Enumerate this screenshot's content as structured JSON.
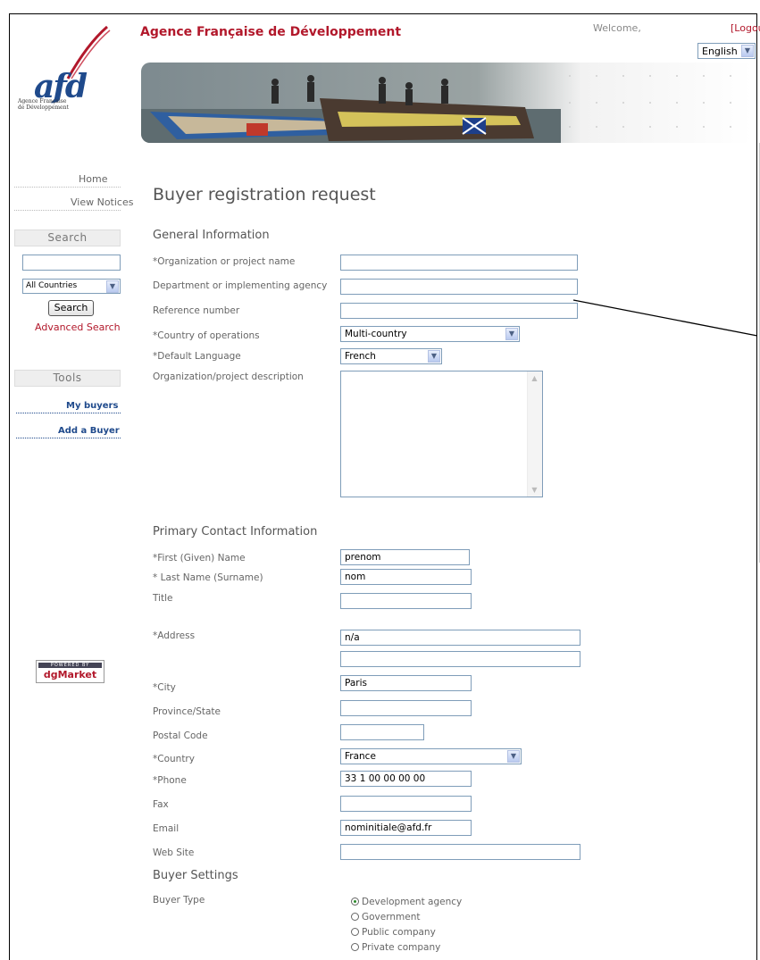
{
  "header": {
    "org_name": "Agence Française de Développement",
    "welcome": "Welcome,",
    "logout": "[Logout]",
    "language": "English"
  },
  "logo": {
    "mark": "afd",
    "subtitle_line1": "Agence Française",
    "subtitle_line2": "de Développement"
  },
  "sidebar": {
    "home": "Home",
    "view_notices": "View Notices",
    "search_heading": "Search",
    "country_select": "All Countries",
    "search_button": "Search",
    "advanced_search": "Advanced Search",
    "tools_heading": "Tools",
    "my_buyers": "My buyers",
    "add_buyer": "Add a Buyer",
    "powered_by": "POWERED BY",
    "powered_brand": "dgMarket"
  },
  "page": {
    "title": "Buyer registration request"
  },
  "general": {
    "heading": "General Information",
    "org_name_label": "*Organization or project name",
    "org_name_value": "",
    "dept_label": "Department or implementing agency",
    "dept_value": "",
    "ref_label": "Reference number",
    "ref_value": "",
    "country_label": "*Country of operations",
    "country_value": "Multi-country",
    "lang_label": "*Default Language",
    "lang_value": "French",
    "desc_label": "Organization/project description"
  },
  "contact": {
    "heading": "Primary Contact Information",
    "first_label": "*First (Given) Name",
    "first_value": "prenom",
    "last_label": "* Last Name (Surname)",
    "last_value": "nom",
    "title_label": "Title",
    "title_value": "",
    "address_label": "*Address",
    "address1_value": "n/a",
    "address2_value": "",
    "city_label": "*City",
    "city_value": "Paris",
    "province_label": "Province/State",
    "province_value": "",
    "postal_label": "Postal Code",
    "postal_value": "",
    "country_label": "*Country",
    "country_value": "France",
    "phone_label": "*Phone",
    "phone_value": "33 1 00 00 00 00",
    "fax_label": "Fax",
    "fax_value": "",
    "email_label": "Email",
    "email_value": "nominitiale@afd.fr",
    "web_label": "Web Site",
    "web_value": ""
  },
  "settings": {
    "heading": "Buyer Settings",
    "type_label": "Buyer Type",
    "options": [
      "Development agency",
      "Government",
      "Public company",
      "Private company"
    ],
    "selected": "Development agency"
  },
  "icons": {
    "dropdown": "chevron-down-icon",
    "radio": "radio-icon"
  }
}
